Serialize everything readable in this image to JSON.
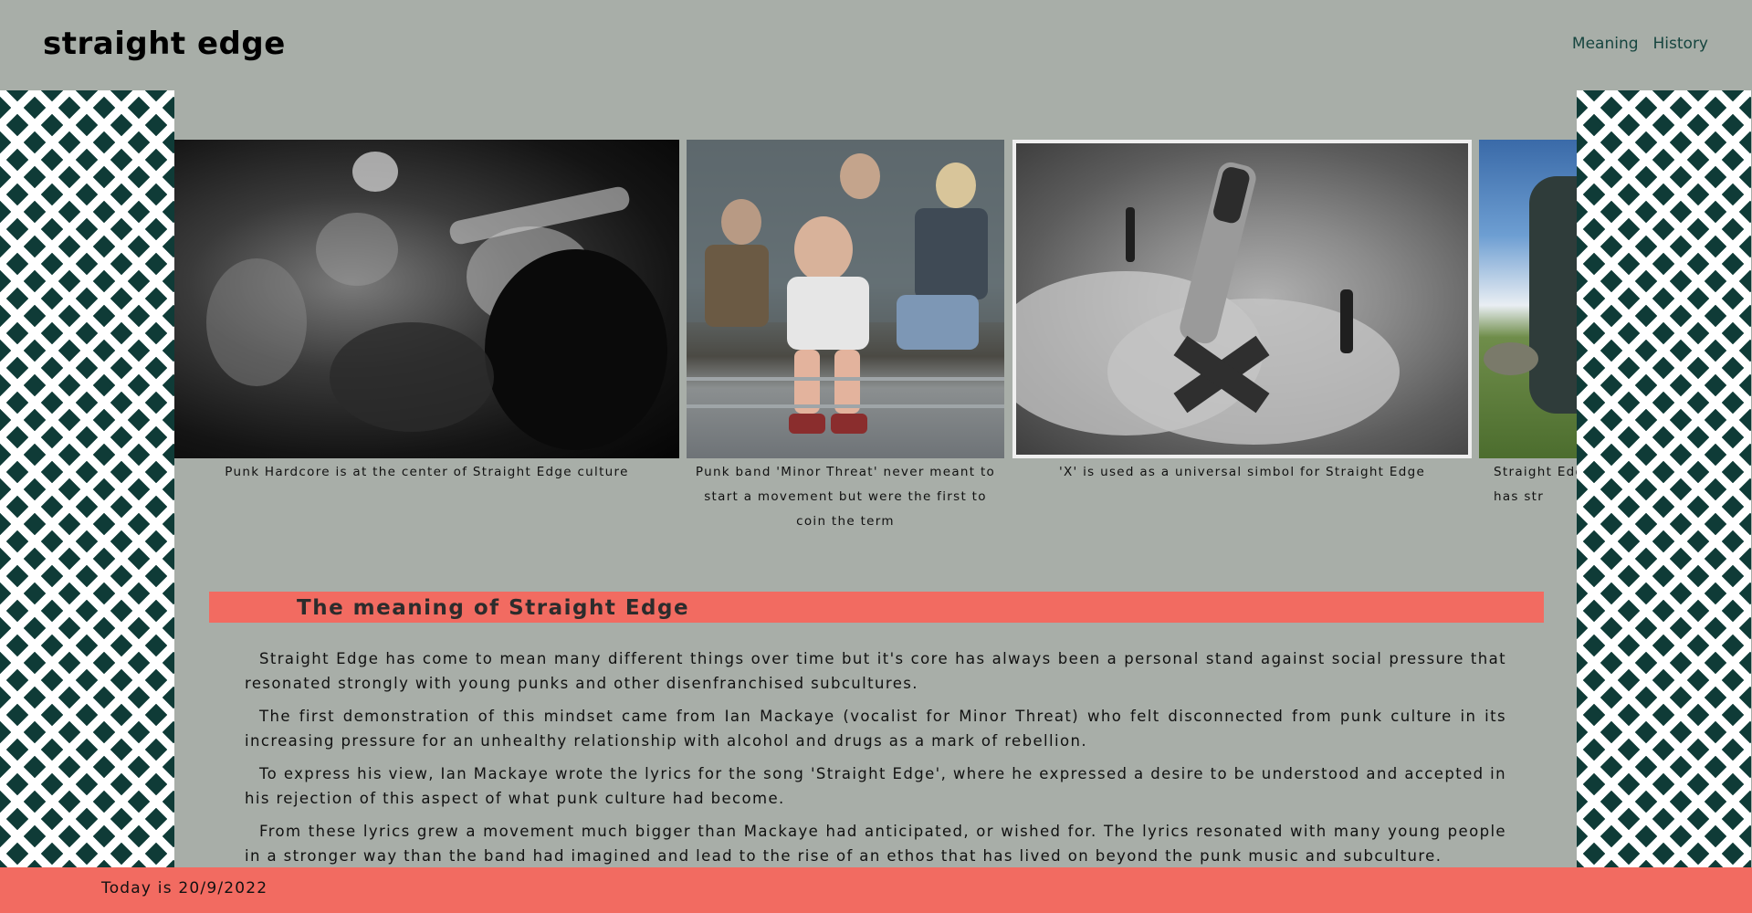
{
  "site": {
    "title": "straight edge"
  },
  "nav": {
    "items": [
      "Meaning",
      "History"
    ]
  },
  "gallery": {
    "slides": [
      {
        "alt": "punk-crowd-photo",
        "caption": "Punk Hardcore is at the center of Straight Edge culture"
      },
      {
        "alt": "minor-threat-band-photo",
        "caption": "Punk band 'Minor Threat' never meant to start a movement but were the first to coin the term"
      },
      {
        "alt": "marker-x-hand-photo",
        "caption": "'X' is used as a universal simbol for Straight Edge"
      },
      {
        "alt": "outdoor-person-photo",
        "caption": "Straight Edge is a movement that has str"
      }
    ]
  },
  "section": {
    "title": "The meaning of Straight Edge",
    "paragraphs": [
      "Straight Edge has come to mean many different things over time but it's core has always been a personal stand against social pressure that resonated strongly with young punks and other disenfranchised subcultures.",
      "The first demonstration of this mindset came from Ian Mackaye (vocalist for Minor Threat) who felt disconnected from punk culture in its increasing pressure for an unhealthy relationship with alcohol and drugs as a mark of rebellion.",
      "To express his view, Ian Mackaye wrote the lyrics for the song 'Straight Edge', where he expressed a desire to be understood and accepted in his rejection of this aspect of what punk culture had become.",
      "From these lyrics grew a movement much bigger than Mackaye had anticipated, or wished for. The lyrics resonated with many young people in a stronger way than the band had imagined and lead to the rise of an ethos that has lived on beyond the punk music and subculture."
    ]
  },
  "footer": {
    "date_text": "Today is 20/9/2022"
  },
  "colors": {
    "background": "#a8aea8",
    "accent": "#f26b61",
    "pattern": "#0f3b37",
    "nav_link": "#16453f"
  }
}
